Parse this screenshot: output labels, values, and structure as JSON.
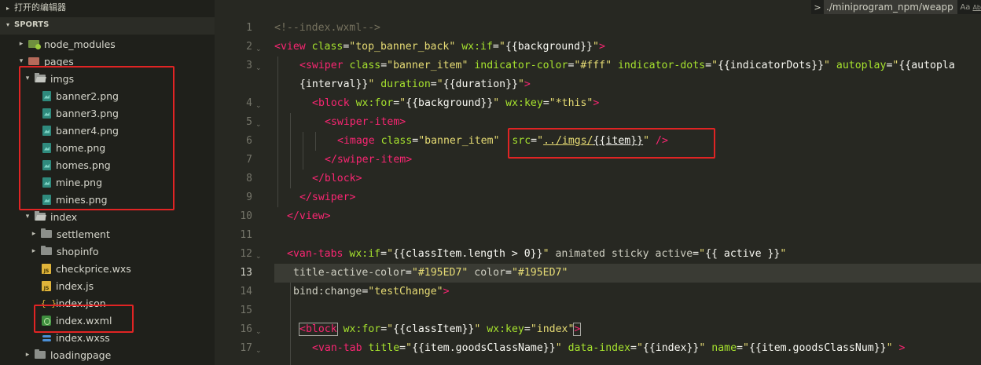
{
  "sidebar": {
    "open_editors_label": "打开的编辑器",
    "project_label": "SPORTS",
    "tree": [
      {
        "label": "node_modules",
        "icon": "folder-npm-icon",
        "twisty": "▸"
      },
      {
        "label": "pages",
        "icon": "folder-pages-icon",
        "twisty": "▾"
      },
      {
        "label": "imgs",
        "icon": "folder-open-icon",
        "twisty": "▾"
      },
      {
        "label": "banner2.png",
        "icon": "image-file-icon"
      },
      {
        "label": "banner3.png",
        "icon": "image-file-icon"
      },
      {
        "label": "banner4.png",
        "icon": "image-file-icon"
      },
      {
        "label": "home.png",
        "icon": "image-file-icon"
      },
      {
        "label": "homes.png",
        "icon": "image-file-icon"
      },
      {
        "label": "mine.png",
        "icon": "image-file-icon"
      },
      {
        "label": "mines.png",
        "icon": "image-file-icon"
      },
      {
        "label": "index",
        "icon": "folder-open-icon",
        "twisty": "▾"
      },
      {
        "label": "settlement",
        "icon": "folder-icon",
        "twisty": "▸"
      },
      {
        "label": "shopinfo",
        "icon": "folder-icon",
        "twisty": "▸"
      },
      {
        "label": "checkprice.wxs",
        "icon": "js-file-icon"
      },
      {
        "label": "index.js",
        "icon": "js-file-icon"
      },
      {
        "label": "index.json",
        "icon": "json-file-icon"
      },
      {
        "label": "index.wxml",
        "icon": "wxml-file-icon"
      },
      {
        "label": "index.wxss",
        "icon": "wxss-file-icon"
      },
      {
        "label": "loadingpage",
        "icon": "folder-icon",
        "twisty": "▸"
      }
    ],
    "json_glyph": "{ }",
    "js_glyph": "JS"
  },
  "find": {
    "chevron": ">",
    "query": "./miniprogram_npm/weapp",
    "match_case": "Aa",
    "whole_word": "Ab"
  },
  "editor": {
    "line_numbers": [
      "1",
      "2",
      "3",
      "",
      "4",
      "5",
      "6",
      "7",
      "8",
      "9",
      "10",
      "11",
      "12",
      "13",
      "14",
      "15",
      "16",
      "17"
    ],
    "active_line": "13",
    "code": {
      "l1": "<!--index.wxml-->",
      "l2_tag": "<view",
      "l2_a1": " class",
      "l2_eq1": "=",
      "l2_s1": "\"top_banner_back\"",
      "l2_a2": " wx:if",
      "l2_eq2": "=",
      "l2_s2a": "\"",
      "l2_b": "{{background}}",
      "l2_s2b": "\"",
      "l2_end": ">",
      "l3_tag": "<swiper",
      "l3_a1": " class",
      "l3_s1": "\"banner_item\"",
      "l3_a2": " indicator-color",
      "l3_s2": "\"#fff\"",
      "l3_a3": " indicator-dots",
      "l3_s3a": "\"",
      "l3_b3": "{{indicatorDots}}",
      "l3_s3b": "\"",
      "l3_a4": " autoplay",
      "l3_s4a": "\"",
      "l3_b4": "{{autopla",
      "l3w_b": "{interval}}",
      "l3w_s": "\"",
      "l3w_a": " duration",
      "l3w_s2a": "\"",
      "l3w_b2": "{{duration}}",
      "l3w_s2b": "\"",
      "l3w_end": ">",
      "l4_tag": "<block",
      "l4_a1": " wx:for",
      "l4_s1a": "\"",
      "l4_b1": "{{background}}",
      "l4_s1b": "\"",
      "l4_a2": " wx:key",
      "l4_s2": "\"*this\"",
      "l4_end": ">",
      "l5_tag": "<swiper-item>",
      "l6_tag": "<image",
      "l6_a1": " class",
      "l6_s1": "\"banner_item\"",
      "l6_a2": "  src",
      "l6_s2a": "\"",
      "l6_s2u": "../imgs/",
      "l6_b": "{{item}}",
      "l6_s2b": "\"",
      "l6_end": " />",
      "l7_tag": "</swiper-item>",
      "l8_tag": "</block>",
      "l9_tag": "</swiper>",
      "l10_tag": "</view>",
      "l12_tag": "<van-tabs",
      "l12_a1": " wx:if",
      "l12_s1a": "\"",
      "l12_b1": "{{classItem.length > 0}}",
      "l12_s1b": "\"",
      "l12_rest_a": " animated sticky active",
      "l12_s2a": "\"",
      "l12_b2": "{{ active }}",
      "l12_s2b": "\"",
      "l13_a1": "title-active-color",
      "l13_s1": "\"#195ED7\"",
      "l13_a2": " color",
      "l13_s2": "\"#195ED7\"",
      "l14_a1": "bind:change",
      "l14_s1": "\"testChange\"",
      "l14_end": ">",
      "l16_tag": "<block",
      "l16_a1": " wx:for",
      "l16_s1a": "\"",
      "l16_b1": "{{classItem}}",
      "l16_s1b": "\"",
      "l16_a2": " wx:key",
      "l16_s2": "\"index\"",
      "l16_end": ">",
      "l17_tag": "<van-tab",
      "l17_a1": " title",
      "l17_s1a": "\"",
      "l17_b1": "{{item.goodsClassName}}",
      "l17_s1b": "\"",
      "l17_a2": " data-index",
      "l17_s2a": "\"",
      "l17_b2": "{{index}}",
      "l17_s2b": "\"",
      "l17_a3": " name",
      "l17_s3a": "\"",
      "l17_b3": "{{item.goodsClassNum}}",
      "l17_s3b": "\"",
      "l17_end": " >"
    }
  },
  "colors": {
    "annotation_box": "#e02424",
    "tag": "#f92672",
    "attribute": "#a6e22e",
    "string": "#e6db74",
    "comment": "#75715e"
  }
}
